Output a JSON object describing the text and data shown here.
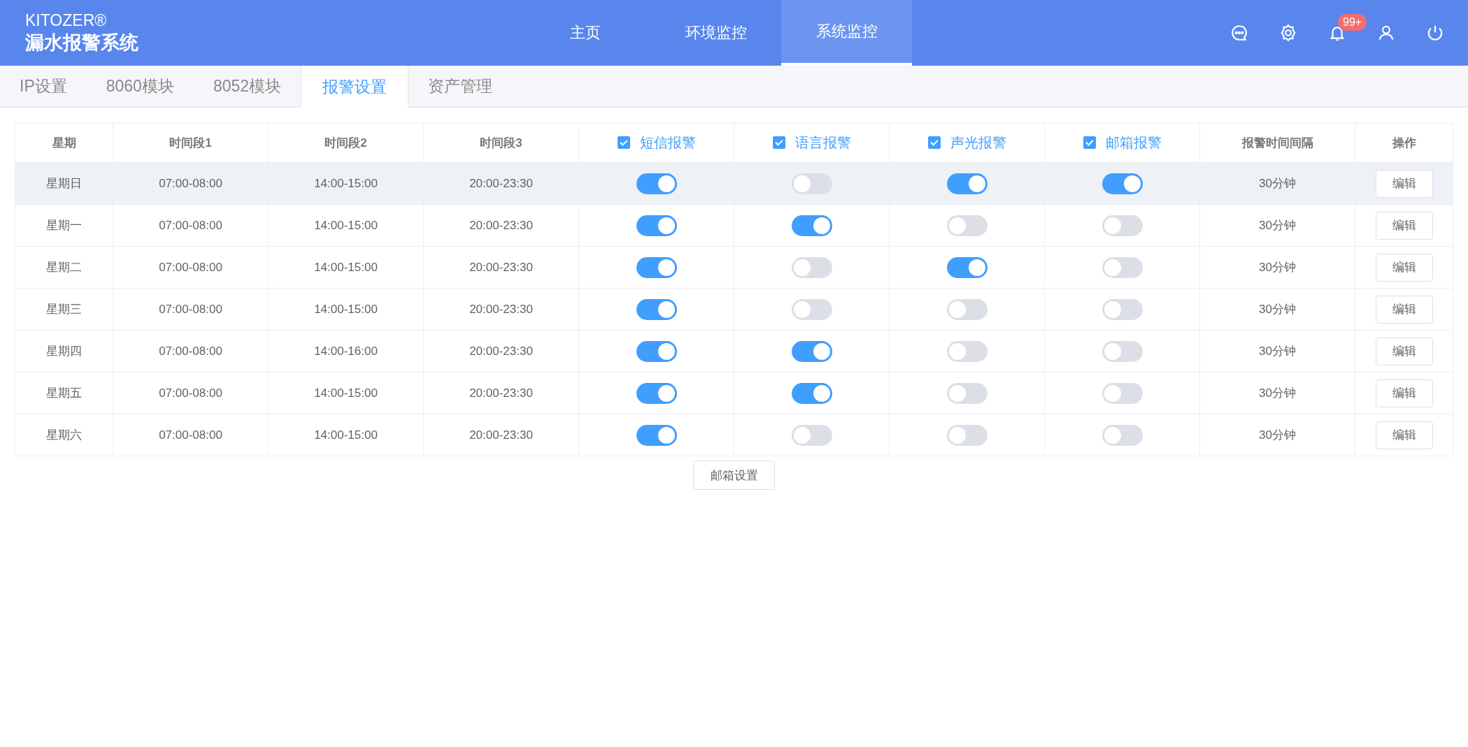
{
  "brand": {
    "name": "KITOZER®",
    "title": "漏水报警系统"
  },
  "nav": [
    {
      "label": "主页",
      "selected": false
    },
    {
      "label": "环境监控",
      "selected": false
    },
    {
      "label": "系统监控",
      "selected": true
    }
  ],
  "header_icons": [
    {
      "kind": "chat"
    },
    {
      "kind": "settings"
    },
    {
      "kind": "bell",
      "badge": "99+"
    },
    {
      "kind": "user"
    },
    {
      "kind": "power"
    }
  ],
  "tabs": [
    {
      "label": "IP设置",
      "selected": false
    },
    {
      "label": "8060模块",
      "selected": false
    },
    {
      "label": "8052模块",
      "selected": false
    },
    {
      "label": "报警设置",
      "selected": true
    },
    {
      "label": "资产管理",
      "selected": false
    }
  ],
  "table": {
    "columns": [
      {
        "label": "星期",
        "kind": "text"
      },
      {
        "label": "时间段1",
        "kind": "text"
      },
      {
        "label": "时间段2",
        "kind": "text"
      },
      {
        "label": "时间段3",
        "kind": "text"
      },
      {
        "label": "短信报警",
        "kind": "check",
        "checked": true
      },
      {
        "label": "语言报警",
        "kind": "check",
        "checked": true
      },
      {
        "label": "声光报警",
        "kind": "check",
        "checked": true
      },
      {
        "label": "邮箱报警",
        "kind": "check",
        "checked": true
      },
      {
        "label": "报警时间间隔",
        "kind": "text"
      },
      {
        "label": "操作",
        "kind": "text"
      }
    ],
    "rows": [
      {
        "day": "星期日",
        "t1": "07:00-08:00",
        "t2": "14:00-15:00",
        "t3": "20:00-23:30",
        "switches": [
          true,
          false,
          true,
          true
        ],
        "interval": "30分钟",
        "action": "编辑",
        "hovered": true
      },
      {
        "day": "星期一",
        "t1": "07:00-08:00",
        "t2": "14:00-15:00",
        "t3": "20:00-23:30",
        "switches": [
          true,
          true,
          false,
          false
        ],
        "interval": "30分钟",
        "action": "编辑",
        "hovered": false
      },
      {
        "day": "星期二",
        "t1": "07:00-08:00",
        "t2": "14:00-15:00",
        "t3": "20:00-23:30",
        "switches": [
          true,
          false,
          true,
          false
        ],
        "interval": "30分钟",
        "action": "编辑",
        "hovered": false
      },
      {
        "day": "星期三",
        "t1": "07:00-08:00",
        "t2": "14:00-15:00",
        "t3": "20:00-23:30",
        "switches": [
          true,
          false,
          false,
          false
        ],
        "interval": "30分钟",
        "action": "编辑",
        "hovered": false
      },
      {
        "day": "星期四",
        "t1": "07:00-08:00",
        "t2": "14:00-16:00",
        "t3": "20:00-23:30",
        "switches": [
          true,
          true,
          false,
          false
        ],
        "interval": "30分钟",
        "action": "编辑",
        "hovered": false
      },
      {
        "day": "星期五",
        "t1": "07:00-08:00",
        "t2": "14:00-15:00",
        "t3": "20:00-23:30",
        "switches": [
          true,
          true,
          false,
          false
        ],
        "interval": "30分钟",
        "action": "编辑",
        "hovered": false
      },
      {
        "day": "星期六",
        "t1": "07:00-08:00",
        "t2": "14:00-15:00",
        "t3": "20:00-23:30",
        "switches": [
          true,
          false,
          false,
          false
        ],
        "interval": "30分钟",
        "action": "编辑",
        "hovered": false
      }
    ]
  },
  "footer_button": "邮箱设置"
}
